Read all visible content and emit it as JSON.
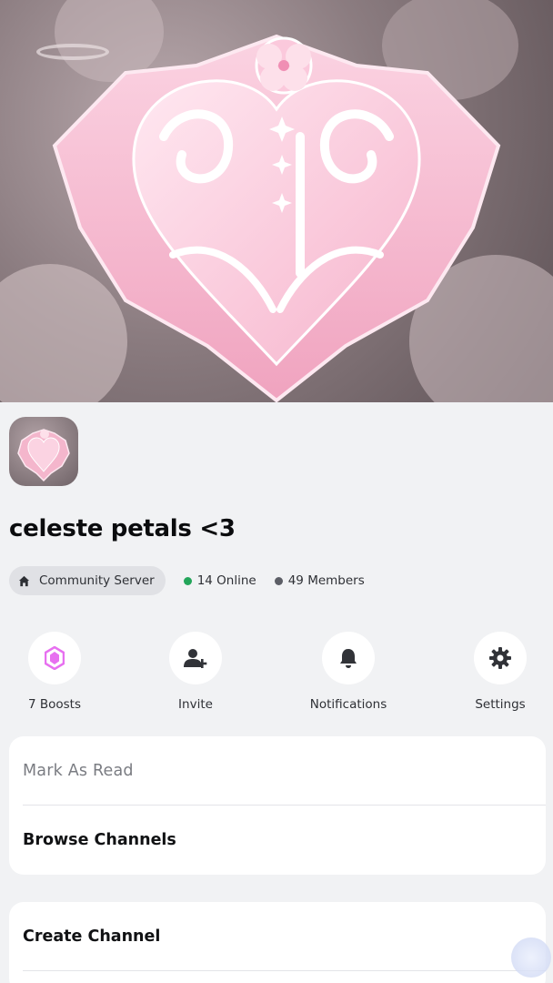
{
  "server": {
    "name": "celeste petals <3",
    "type_label": "Community Server",
    "online": "14 Online",
    "members": "49 Members"
  },
  "actions": [
    {
      "label": "7 Boosts",
      "icon": "boost-gem-icon"
    },
    {
      "label": "Invite",
      "icon": "add-person-icon"
    },
    {
      "label": "Notifications",
      "icon": "bell-icon"
    },
    {
      "label": "Settings",
      "icon": "gear-icon"
    }
  ],
  "menu": {
    "mark_as_read": "Mark As Read",
    "browse_channels": "Browse Channels",
    "create_channel": "Create Channel"
  },
  "colors": {
    "online_dot": "#23a55a",
    "members_dot": "#5c5e66",
    "boost_accent": "#e770f0",
    "crest_pink": "#f4b6cc"
  }
}
